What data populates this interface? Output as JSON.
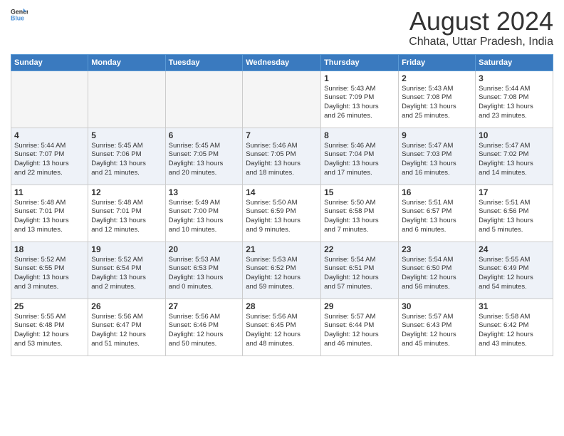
{
  "header": {
    "logo_general": "General",
    "logo_blue": "Blue",
    "main_title": "August 2024",
    "sub_title": "Chhata, Uttar Pradesh, India"
  },
  "calendar": {
    "days_of_week": [
      "Sunday",
      "Monday",
      "Tuesday",
      "Wednesday",
      "Thursday",
      "Friday",
      "Saturday"
    ],
    "weeks": [
      [
        {
          "day": "",
          "info": ""
        },
        {
          "day": "",
          "info": ""
        },
        {
          "day": "",
          "info": ""
        },
        {
          "day": "",
          "info": ""
        },
        {
          "day": "1",
          "info": "Sunrise: 5:43 AM\nSunset: 7:09 PM\nDaylight: 13 hours\nand 26 minutes."
        },
        {
          "day": "2",
          "info": "Sunrise: 5:43 AM\nSunset: 7:08 PM\nDaylight: 13 hours\nand 25 minutes."
        },
        {
          "day": "3",
          "info": "Sunrise: 5:44 AM\nSunset: 7:08 PM\nDaylight: 13 hours\nand 23 minutes."
        }
      ],
      [
        {
          "day": "4",
          "info": "Sunrise: 5:44 AM\nSunset: 7:07 PM\nDaylight: 13 hours\nand 22 minutes."
        },
        {
          "day": "5",
          "info": "Sunrise: 5:45 AM\nSunset: 7:06 PM\nDaylight: 13 hours\nand 21 minutes."
        },
        {
          "day": "6",
          "info": "Sunrise: 5:45 AM\nSunset: 7:05 PM\nDaylight: 13 hours\nand 20 minutes."
        },
        {
          "day": "7",
          "info": "Sunrise: 5:46 AM\nSunset: 7:05 PM\nDaylight: 13 hours\nand 18 minutes."
        },
        {
          "day": "8",
          "info": "Sunrise: 5:46 AM\nSunset: 7:04 PM\nDaylight: 13 hours\nand 17 minutes."
        },
        {
          "day": "9",
          "info": "Sunrise: 5:47 AM\nSunset: 7:03 PM\nDaylight: 13 hours\nand 16 minutes."
        },
        {
          "day": "10",
          "info": "Sunrise: 5:47 AM\nSunset: 7:02 PM\nDaylight: 13 hours\nand 14 minutes."
        }
      ],
      [
        {
          "day": "11",
          "info": "Sunrise: 5:48 AM\nSunset: 7:01 PM\nDaylight: 13 hours\nand 13 minutes."
        },
        {
          "day": "12",
          "info": "Sunrise: 5:48 AM\nSunset: 7:01 PM\nDaylight: 13 hours\nand 12 minutes."
        },
        {
          "day": "13",
          "info": "Sunrise: 5:49 AM\nSunset: 7:00 PM\nDaylight: 13 hours\nand 10 minutes."
        },
        {
          "day": "14",
          "info": "Sunrise: 5:50 AM\nSunset: 6:59 PM\nDaylight: 13 hours\nand 9 minutes."
        },
        {
          "day": "15",
          "info": "Sunrise: 5:50 AM\nSunset: 6:58 PM\nDaylight: 13 hours\nand 7 minutes."
        },
        {
          "day": "16",
          "info": "Sunrise: 5:51 AM\nSunset: 6:57 PM\nDaylight: 13 hours\nand 6 minutes."
        },
        {
          "day": "17",
          "info": "Sunrise: 5:51 AM\nSunset: 6:56 PM\nDaylight: 13 hours\nand 5 minutes."
        }
      ],
      [
        {
          "day": "18",
          "info": "Sunrise: 5:52 AM\nSunset: 6:55 PM\nDaylight: 13 hours\nand 3 minutes."
        },
        {
          "day": "19",
          "info": "Sunrise: 5:52 AM\nSunset: 6:54 PM\nDaylight: 13 hours\nand 2 minutes."
        },
        {
          "day": "20",
          "info": "Sunrise: 5:53 AM\nSunset: 6:53 PM\nDaylight: 13 hours\nand 0 minutes."
        },
        {
          "day": "21",
          "info": "Sunrise: 5:53 AM\nSunset: 6:52 PM\nDaylight: 12 hours\nand 59 minutes."
        },
        {
          "day": "22",
          "info": "Sunrise: 5:54 AM\nSunset: 6:51 PM\nDaylight: 12 hours\nand 57 minutes."
        },
        {
          "day": "23",
          "info": "Sunrise: 5:54 AM\nSunset: 6:50 PM\nDaylight: 12 hours\nand 56 minutes."
        },
        {
          "day": "24",
          "info": "Sunrise: 5:55 AM\nSunset: 6:49 PM\nDaylight: 12 hours\nand 54 minutes."
        }
      ],
      [
        {
          "day": "25",
          "info": "Sunrise: 5:55 AM\nSunset: 6:48 PM\nDaylight: 12 hours\nand 53 minutes."
        },
        {
          "day": "26",
          "info": "Sunrise: 5:56 AM\nSunset: 6:47 PM\nDaylight: 12 hours\nand 51 minutes."
        },
        {
          "day": "27",
          "info": "Sunrise: 5:56 AM\nSunset: 6:46 PM\nDaylight: 12 hours\nand 50 minutes."
        },
        {
          "day": "28",
          "info": "Sunrise: 5:56 AM\nSunset: 6:45 PM\nDaylight: 12 hours\nand 48 minutes."
        },
        {
          "day": "29",
          "info": "Sunrise: 5:57 AM\nSunset: 6:44 PM\nDaylight: 12 hours\nand 46 minutes."
        },
        {
          "day": "30",
          "info": "Sunrise: 5:57 AM\nSunset: 6:43 PM\nDaylight: 12 hours\nand 45 minutes."
        },
        {
          "day": "31",
          "info": "Sunrise: 5:58 AM\nSunset: 6:42 PM\nDaylight: 12 hours\nand 43 minutes."
        }
      ]
    ]
  }
}
